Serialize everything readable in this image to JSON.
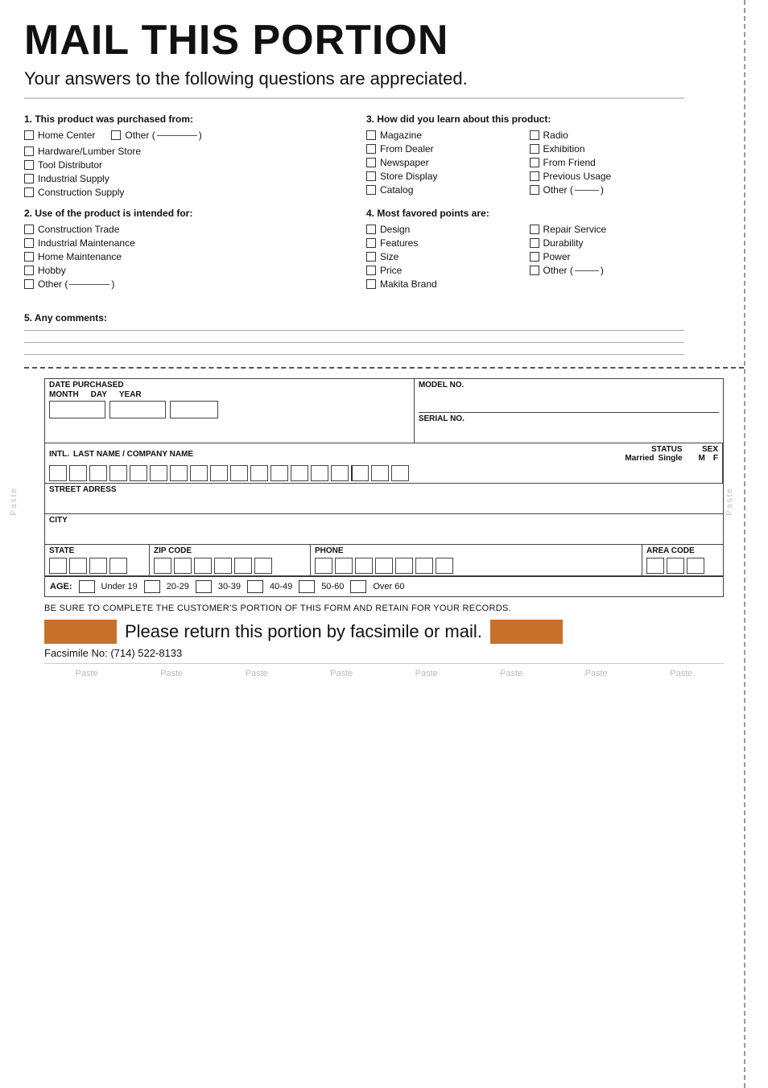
{
  "title": "MAIL THIS PORTION",
  "subtitle": "Your answers to the following questions are appreciated.",
  "q1": {
    "title": "1. This product was purchased from:",
    "options": [
      {
        "label": "Home Center"
      },
      {
        "label": "Other (",
        "extra": " )"
      },
      {
        "label": "Hardware/Lumber Store"
      },
      {
        "label": "Tool Distributor"
      },
      {
        "label": "Industrial Supply"
      },
      {
        "label": "Construction Supply"
      }
    ]
  },
  "q2": {
    "title": "2. Use of the product is intended for:",
    "options": [
      {
        "label": "Construction Trade"
      },
      {
        "label": "Industrial Maintenance"
      },
      {
        "label": "Home Maintenance"
      },
      {
        "label": "Hobby"
      },
      {
        "label": "Other (",
        "extra": " )"
      }
    ]
  },
  "q3": {
    "title": "3. How did you learn about this product:",
    "col1": [
      "Magazine",
      "From Dealer",
      "Newspaper",
      "Store Display",
      "Catalog"
    ],
    "col2": [
      "Radio",
      "Exhibition",
      "From Friend",
      "Previous Usage",
      "Other (  )"
    ]
  },
  "q4": {
    "title": "4. Most favored points are:",
    "col1": [
      "Design",
      "Features",
      "Size",
      "Price",
      "Makita Brand"
    ],
    "col2": [
      "Repair Service",
      "Durability",
      "Power",
      "Other (  )"
    ]
  },
  "q5": {
    "title": "5. Any comments:"
  },
  "form": {
    "date_purchased": "DATE PURCHASED",
    "month": "MONTH",
    "day": "DAY",
    "year": "YEAR",
    "model_no": "MODEL NO.",
    "serial_no": "SERIAL NO.",
    "intl": "INTL.",
    "last_name": "LAST NAME / COMPANY NAME",
    "status": "STATUS",
    "married": "Married",
    "single": "Single",
    "sex": "SEX",
    "m": "M",
    "f": "F",
    "street": "STREET ADRESS",
    "city": "CITY",
    "state": "STATE",
    "zip": "ZIP CODE",
    "phone": "PHONE",
    "area_code": "AREA CODE",
    "age_label": "AGE:",
    "age_options": [
      "Under 19",
      "20-29",
      "30-39",
      "40-49",
      "50-60",
      "Over 60"
    ],
    "bottom_note": "BE SURE TO COMPLETE THE CUSTOMER'S PORTION OF THIS FORM AND RETAIN FOR YOUR RECORDS.",
    "return_text": "Please return this portion by facsimile or mail.",
    "fax": "Facsimile No: (714) 522-8133"
  },
  "paste_labels": [
    "Paste",
    "Paste",
    "Paste",
    "Paste",
    "Paste",
    "Paste",
    "Paste",
    "Paste"
  ]
}
